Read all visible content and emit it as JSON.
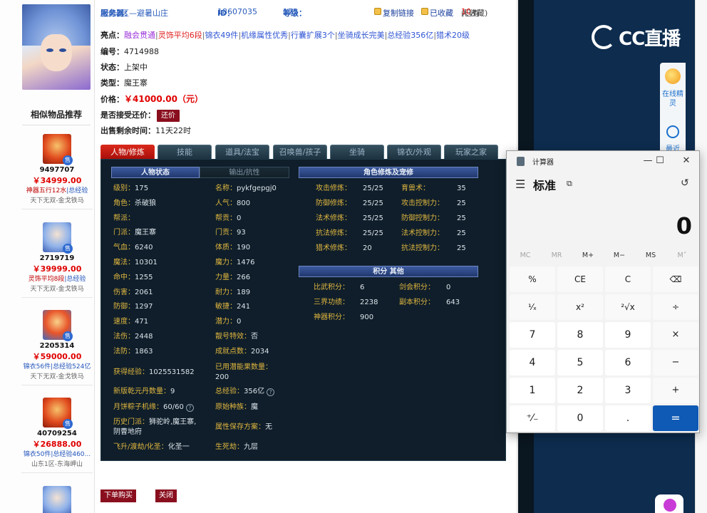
{
  "sidebar": {
    "similar_title": "相似物品推荐",
    "items": [
      {
        "id": "9497707",
        "price": "￥34999.00",
        "tag_hl": "神器五行12水",
        "tag_rest": "|总经验",
        "server": "天下无双-金戈铁马"
      },
      {
        "id": "2719719",
        "price": "￥39999.00",
        "tag_hl": "灵饰平均8段",
        "tag_rest": "|总经验",
        "server": "天下无双-金戈铁马"
      },
      {
        "id": "2205314",
        "price": "￥59000.00",
        "tag_hl": "",
        "tag_rest": "锦衣56件|总经验524亿",
        "server": "天下无双-金戈铁马"
      },
      {
        "id": "40709254",
        "price": "￥26888.00",
        "tag_hl": "",
        "tag_rest": "锦衣50件|总经验460...",
        "server": "山东1区-东海岬山"
      }
    ],
    "sale_badge": "售"
  },
  "top": {
    "server_label": "服务器：",
    "server_value": "河北3区—避暑山庄",
    "id_label": "ID：",
    "id_value": "18607035",
    "level_label": "等级：",
    "level_value": "175",
    "copy_link": "复制链接",
    "favorited": "已收藏",
    "fav_count_pre": "(已有",
    "fav_count_n": "10",
    "fav_count_post": "人收藏)"
  },
  "info": {
    "highlights_label": "亮点：",
    "highlights": [
      {
        "text": "融会贯通",
        "color": "p"
      },
      {
        "text": "灵饰平均6段",
        "color": "r"
      },
      {
        "text": "锦衣49件",
        "color": "b"
      },
      {
        "text": "机缘属性优秀",
        "color": "b"
      },
      {
        "text": "行囊扩展3个",
        "color": "b"
      },
      {
        "text": "坐骑成长完美",
        "color": "b"
      },
      {
        "text": "总经验356亿",
        "color": "b"
      },
      {
        "text": "猎术20级",
        "color": "b"
      }
    ],
    "serial_label": "编号：",
    "serial_value": "4714988",
    "status_label": "状态：",
    "status_value": "上架中",
    "type_label": "类型：",
    "type_value": "魔王寨",
    "price_label": "价格：",
    "price_value": "￥41000.00（元）",
    "bargain_label": "是否接受还价：",
    "bargain_button": "还价",
    "remaining_label": "出售剩余时间：",
    "remaining_value": "11天22时"
  },
  "tabs": [
    "人物/修炼",
    "技能",
    "道具/法宝",
    "召唤兽/孩子",
    "坐骑",
    "锦衣/外观",
    "玩家之家"
  ],
  "panel": {
    "head_status": "人物状态",
    "head_resist": "输出/抗性",
    "head_cultivation": "角色修炼及宠修",
    "head_points": "积分 其他",
    "left_col": [
      {
        "k": "级别：",
        "v": "175"
      },
      {
        "k": "角色：",
        "v": "杀破狼"
      },
      {
        "k": "帮派：",
        "v": ""
      },
      {
        "k": "门派：",
        "v": "魔王寨"
      },
      {
        "k": "气血：",
        "v": "6240"
      },
      {
        "k": "魔法：",
        "v": "10301"
      },
      {
        "k": "命中：",
        "v": "1255"
      },
      {
        "k": "伤害：",
        "v": "2061"
      },
      {
        "k": "防御：",
        "v": "1297"
      },
      {
        "k": "速度：",
        "v": "471"
      },
      {
        "k": "法伤：",
        "v": "2448"
      },
      {
        "k": "法防：",
        "v": "1863"
      }
    ],
    "right_col": [
      {
        "k": "名称：",
        "v": "pykfgepgj0"
      },
      {
        "k": "人气：",
        "v": "800"
      },
      {
        "k": "帮贡：",
        "v": "0"
      },
      {
        "k": "门贡：",
        "v": "93"
      },
      {
        "k": "体质：",
        "v": "190"
      },
      {
        "k": "魔力：",
        "v": "1476"
      },
      {
        "k": "力量：",
        "v": "266"
      },
      {
        "k": "耐力：",
        "v": "189"
      },
      {
        "k": "敏捷：",
        "v": "241"
      },
      {
        "k": "潜力：",
        "v": "0"
      },
      {
        "k": "靓号特效：",
        "v": "否"
      },
      {
        "k": "成就点数：",
        "v": "2034"
      }
    ],
    "exp": {
      "k": "获得经验：",
      "v": "1025531582"
    },
    "used_potential": {
      "k": "已用潜能果数量：",
      "v": "200"
    },
    "qianyuan": {
      "k": "新版乾元丹数量：",
      "v": "9"
    },
    "total_exp": {
      "k": "总经验：",
      "v": "356亿"
    },
    "mooncake": {
      "k": "月饼粽子机缘：",
      "v": "60/60"
    },
    "race": {
      "k": "原始种族：",
      "v": "魔"
    },
    "history": {
      "k": "历史门派：",
      "v": "狮驼岭,魔王寨,",
      "v2": "阴曹地府"
    },
    "attr_save": {
      "k": "属性保存方案：",
      "v": "无"
    },
    "ascend": {
      "k": "飞升/渡劫/化圣：",
      "v": "化圣一"
    },
    "birth_death": {
      "k": "生死劫：",
      "v": "九层"
    },
    "cult_left": [
      {
        "k": "攻击修炼：",
        "v": "25/25"
      },
      {
        "k": "防御修炼：",
        "v": "25/25"
      },
      {
        "k": "法术修炼：",
        "v": "25/25"
      },
      {
        "k": "抗法修炼：",
        "v": "25/25"
      },
      {
        "k": "猎术修炼：",
        "v": "20"
      }
    ],
    "cult_right": [
      {
        "k": "育兽术：",
        "v": "35"
      },
      {
        "k": "攻击控制力：",
        "v": "25"
      },
      {
        "k": "防御控制力：",
        "v": "25"
      },
      {
        "k": "法术控制力：",
        "v": "25"
      },
      {
        "k": "抗法控制力：",
        "v": "25"
      }
    ],
    "points_left": [
      {
        "k": "比武积分：",
        "v": "6"
      },
      {
        "k": "三界功绩：",
        "v": "2238"
      },
      {
        "k": "神器积分：",
        "v": "900"
      }
    ],
    "points_right": [
      {
        "k": "剑会积分：",
        "v": "0"
      },
      {
        "k": "副本积分：",
        "v": "643"
      }
    ]
  },
  "actions": {
    "buy": "下单购买",
    "close": "关闭"
  },
  "right": {
    "logo_text": "CC直播",
    "online_label": "在线精灵",
    "recent_label": "最近"
  },
  "calculator": {
    "title": "计算器",
    "mode": "标准",
    "display": "0",
    "memory": [
      {
        "label": "MC",
        "disabled": true
      },
      {
        "label": "MR",
        "disabled": true
      },
      {
        "label": "M+",
        "disabled": false
      },
      {
        "label": "M−",
        "disabled": false
      },
      {
        "label": "MS",
        "disabled": false
      },
      {
        "label": "M˅",
        "disabled": true
      }
    ],
    "keys": [
      [
        "%",
        "CE",
        "C",
        "⌫"
      ],
      [
        "¹⁄ₓ",
        "x²",
        "²√x",
        "÷"
      ],
      [
        "7",
        "8",
        "9",
        "×"
      ],
      [
        "4",
        "5",
        "6",
        "−"
      ],
      [
        "1",
        "2",
        "3",
        "+"
      ],
      [
        "⁺⁄₋",
        "0",
        ".",
        "="
      ]
    ]
  }
}
